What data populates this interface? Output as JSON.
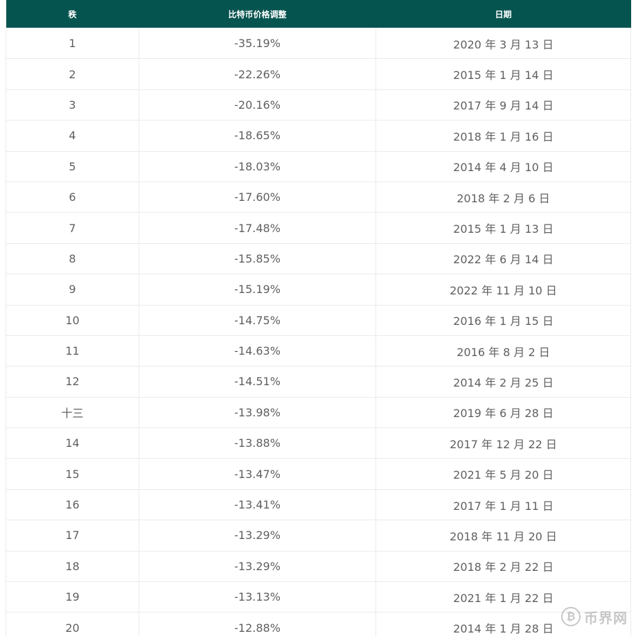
{
  "table": {
    "headers": [
      "秩",
      "比特币价格调整",
      "日期"
    ],
    "rows": [
      [
        "1",
        "-35.19%",
        "2020 年 3 月 13 日"
      ],
      [
        "2",
        "-22.26%",
        "2015 年 1 月 14 日"
      ],
      [
        "3",
        "-20.16%",
        "2017 年 9 月 14 日"
      ],
      [
        "4",
        "-18.65%",
        "2018 年 1 月 16 日"
      ],
      [
        "5",
        "-18.03%",
        "2014 年 4 月 10 日"
      ],
      [
        "6",
        "-17.60%",
        "2018 年 2 月 6 日"
      ],
      [
        "7",
        "-17.48%",
        "2015 年 1 月 13 日"
      ],
      [
        "8",
        "-15.85%",
        "2022 年 6 月 14 日"
      ],
      [
        "9",
        "-15.19%",
        "2022 年 11 月 10 日"
      ],
      [
        "10",
        "-14.75%",
        "2016 年 1 月 15 日"
      ],
      [
        "11",
        "-14.63%",
        "2016 年 8 月 2 日"
      ],
      [
        "12",
        "-14.51%",
        "2014 年 2 月 25 日"
      ],
      [
        "十三",
        "-13.98%",
        "2019 年 6 月 28 日"
      ],
      [
        "14",
        "-13.88%",
        "2017 年 12 月 22 日"
      ],
      [
        "15",
        "-13.47%",
        "2021 年 5 月 20 日"
      ],
      [
        "16",
        "-13.41%",
        "2017 年 1 月 11 日"
      ],
      [
        "17",
        "-13.29%",
        "2018 年 11 月 20 日"
      ],
      [
        "18",
        "-13.29%",
        "2018 年 2 月 22 日"
      ],
      [
        "19",
        "-13.13%",
        "2021 年 1 月 22 日"
      ],
      [
        "20",
        "-12.88%",
        "2014 年 1 月 28 日"
      ]
    ]
  },
  "watermark": {
    "logo_glyph": "₿",
    "text": "币界网"
  },
  "colors": {
    "header_bg": "#065450",
    "header_text": "#ffffff",
    "cell_text": "#5f5f5f",
    "grid_line": "#ebebeb"
  }
}
